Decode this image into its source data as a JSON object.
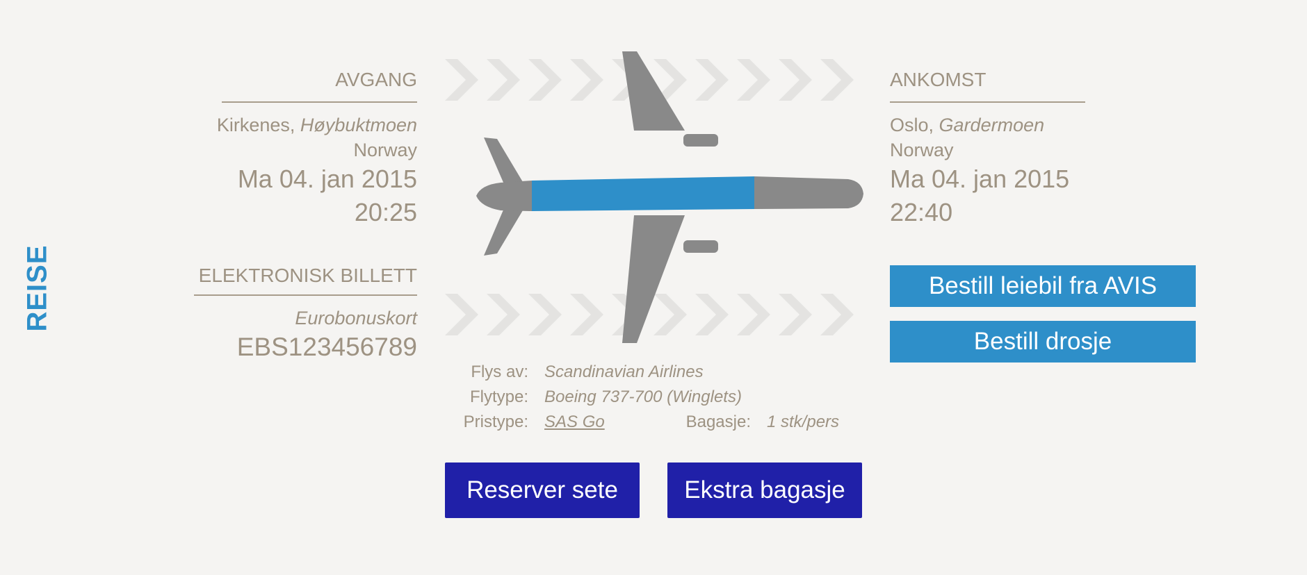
{
  "side_label": "REISE",
  "departure": {
    "heading": "AVGANG",
    "city": "Kirkenes,",
    "airport": "Høybuktmoen",
    "country": "Norway",
    "date": "Ma 04. jan 2015",
    "time": "20:25"
  },
  "arrival": {
    "heading": "ANKOMST",
    "city": "Oslo,",
    "airport": "Gardermoen",
    "country": "Norway",
    "date": "Ma 04. jan 2015",
    "time": "22:40"
  },
  "ticket": {
    "heading": "ELEKTRONISK BILLETT",
    "type": "Eurobonuskort",
    "number": "EBS123456789"
  },
  "flight_info": {
    "operated_by_label": "Flys av:",
    "operated_by": "Scandinavian Airlines",
    "aircraft_label": "Flytype:",
    "aircraft": "Boeing 737-700 (Winglets)",
    "fare_label": "Pristype:",
    "fare": "SAS Go",
    "baggage_label": "Bagasje:",
    "baggage": "1 stk/pers"
  },
  "actions": {
    "rent_car": "Bestill leiebil fra AVIS",
    "taxi": "Bestill drosje",
    "reserve_seat": "Reserver sete",
    "extra_baggage": "Ekstra bagasje"
  },
  "icons": {
    "airplane": "airplane-icon",
    "chevrons": "chevron-right-icon"
  },
  "colors": {
    "accent_blue": "#2e8fc9",
    "navy": "#2020a8",
    "text": "#9d9282",
    "plane_body": "#898989",
    "chevrons": "#e4e3e1"
  }
}
